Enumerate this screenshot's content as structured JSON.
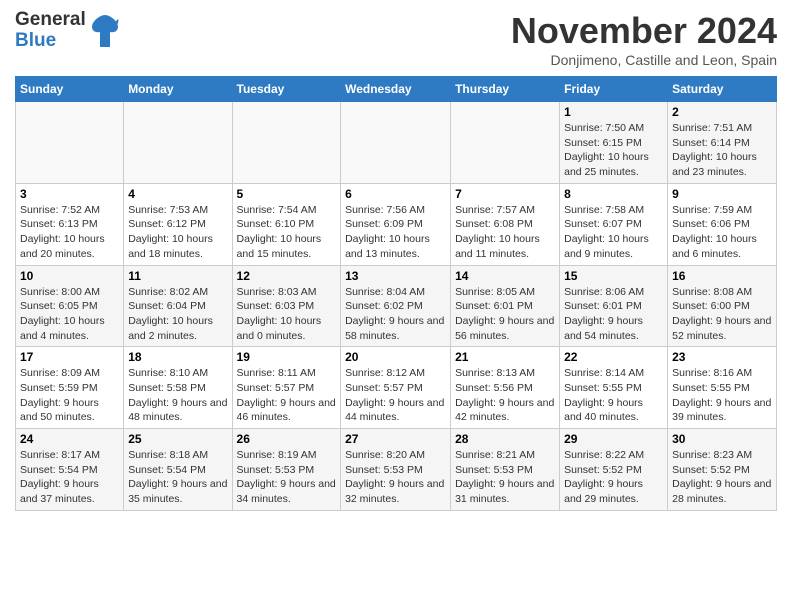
{
  "header": {
    "logo_general": "General",
    "logo_blue": "Blue",
    "month_title": "November 2024",
    "location": "Donjimeno, Castille and Leon, Spain"
  },
  "days_of_week": [
    "Sunday",
    "Monday",
    "Tuesday",
    "Wednesday",
    "Thursday",
    "Friday",
    "Saturday"
  ],
  "weeks": [
    [
      {
        "day": "",
        "info": ""
      },
      {
        "day": "",
        "info": ""
      },
      {
        "day": "",
        "info": ""
      },
      {
        "day": "",
        "info": ""
      },
      {
        "day": "",
        "info": ""
      },
      {
        "day": "1",
        "info": "Sunrise: 7:50 AM\nSunset: 6:15 PM\nDaylight: 10 hours and 25 minutes."
      },
      {
        "day": "2",
        "info": "Sunrise: 7:51 AM\nSunset: 6:14 PM\nDaylight: 10 hours and 23 minutes."
      }
    ],
    [
      {
        "day": "3",
        "info": "Sunrise: 7:52 AM\nSunset: 6:13 PM\nDaylight: 10 hours and 20 minutes."
      },
      {
        "day": "4",
        "info": "Sunrise: 7:53 AM\nSunset: 6:12 PM\nDaylight: 10 hours and 18 minutes."
      },
      {
        "day": "5",
        "info": "Sunrise: 7:54 AM\nSunset: 6:10 PM\nDaylight: 10 hours and 15 minutes."
      },
      {
        "day": "6",
        "info": "Sunrise: 7:56 AM\nSunset: 6:09 PM\nDaylight: 10 hours and 13 minutes."
      },
      {
        "day": "7",
        "info": "Sunrise: 7:57 AM\nSunset: 6:08 PM\nDaylight: 10 hours and 11 minutes."
      },
      {
        "day": "8",
        "info": "Sunrise: 7:58 AM\nSunset: 6:07 PM\nDaylight: 10 hours and 9 minutes."
      },
      {
        "day": "9",
        "info": "Sunrise: 7:59 AM\nSunset: 6:06 PM\nDaylight: 10 hours and 6 minutes."
      }
    ],
    [
      {
        "day": "10",
        "info": "Sunrise: 8:00 AM\nSunset: 6:05 PM\nDaylight: 10 hours and 4 minutes."
      },
      {
        "day": "11",
        "info": "Sunrise: 8:02 AM\nSunset: 6:04 PM\nDaylight: 10 hours and 2 minutes."
      },
      {
        "day": "12",
        "info": "Sunrise: 8:03 AM\nSunset: 6:03 PM\nDaylight: 10 hours and 0 minutes."
      },
      {
        "day": "13",
        "info": "Sunrise: 8:04 AM\nSunset: 6:02 PM\nDaylight: 9 hours and 58 minutes."
      },
      {
        "day": "14",
        "info": "Sunrise: 8:05 AM\nSunset: 6:01 PM\nDaylight: 9 hours and 56 minutes."
      },
      {
        "day": "15",
        "info": "Sunrise: 8:06 AM\nSunset: 6:01 PM\nDaylight: 9 hours and 54 minutes."
      },
      {
        "day": "16",
        "info": "Sunrise: 8:08 AM\nSunset: 6:00 PM\nDaylight: 9 hours and 52 minutes."
      }
    ],
    [
      {
        "day": "17",
        "info": "Sunrise: 8:09 AM\nSunset: 5:59 PM\nDaylight: 9 hours and 50 minutes."
      },
      {
        "day": "18",
        "info": "Sunrise: 8:10 AM\nSunset: 5:58 PM\nDaylight: 9 hours and 48 minutes."
      },
      {
        "day": "19",
        "info": "Sunrise: 8:11 AM\nSunset: 5:57 PM\nDaylight: 9 hours and 46 minutes."
      },
      {
        "day": "20",
        "info": "Sunrise: 8:12 AM\nSunset: 5:57 PM\nDaylight: 9 hours and 44 minutes."
      },
      {
        "day": "21",
        "info": "Sunrise: 8:13 AM\nSunset: 5:56 PM\nDaylight: 9 hours and 42 minutes."
      },
      {
        "day": "22",
        "info": "Sunrise: 8:14 AM\nSunset: 5:55 PM\nDaylight: 9 hours and 40 minutes."
      },
      {
        "day": "23",
        "info": "Sunrise: 8:16 AM\nSunset: 5:55 PM\nDaylight: 9 hours and 39 minutes."
      }
    ],
    [
      {
        "day": "24",
        "info": "Sunrise: 8:17 AM\nSunset: 5:54 PM\nDaylight: 9 hours and 37 minutes."
      },
      {
        "day": "25",
        "info": "Sunrise: 8:18 AM\nSunset: 5:54 PM\nDaylight: 9 hours and 35 minutes."
      },
      {
        "day": "26",
        "info": "Sunrise: 8:19 AM\nSunset: 5:53 PM\nDaylight: 9 hours and 34 minutes."
      },
      {
        "day": "27",
        "info": "Sunrise: 8:20 AM\nSunset: 5:53 PM\nDaylight: 9 hours and 32 minutes."
      },
      {
        "day": "28",
        "info": "Sunrise: 8:21 AM\nSunset: 5:53 PM\nDaylight: 9 hours and 31 minutes."
      },
      {
        "day": "29",
        "info": "Sunrise: 8:22 AM\nSunset: 5:52 PM\nDaylight: 9 hours and 29 minutes."
      },
      {
        "day": "30",
        "info": "Sunrise: 8:23 AM\nSunset: 5:52 PM\nDaylight: 9 hours and 28 minutes."
      }
    ]
  ]
}
